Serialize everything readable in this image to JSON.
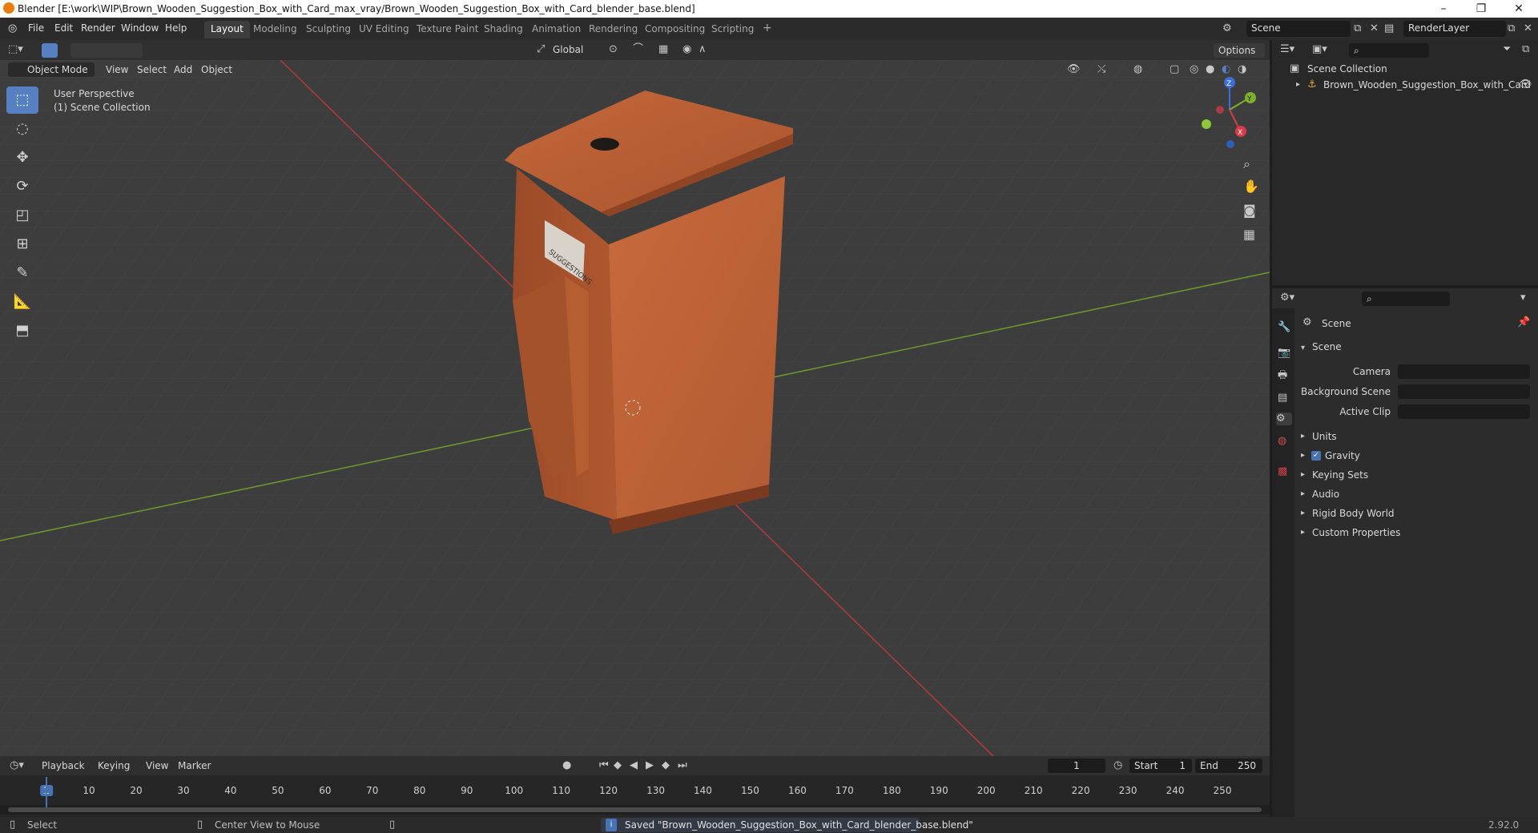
{
  "window": {
    "title": "Blender [E:\\work\\WIP\\Brown_Wooden_Suggestion_Box_with_Card_max_vray/Brown_Wooden_Suggestion_Box_with_Card_blender_base.blend]",
    "minimize": "–",
    "maximize": "❐",
    "close": "✕"
  },
  "menu": [
    "File",
    "Edit",
    "Render",
    "Window",
    "Help"
  ],
  "workspaces": [
    "Layout",
    "Modeling",
    "Sculpting",
    "UV Editing",
    "Texture Paint",
    "Shading",
    "Animation",
    "Rendering",
    "Compositing",
    "Scripting"
  ],
  "workspace_add": "+",
  "scene_field": "Scene",
  "renderlayer_field": "RenderLayer",
  "viewport_header": {
    "transform_orientation": "Global",
    "options": "Options",
    "mode": "Object Mode",
    "view": "View",
    "select": "Select",
    "add": "Add",
    "object": "Object"
  },
  "viewport": {
    "perspective": "User Perspective",
    "collection": "(1) Scene Collection",
    "box_card_text": "SUGGESTIONS",
    "gizmo": {
      "x": "X",
      "y": "Y",
      "z": "Z"
    }
  },
  "outliner": {
    "root": "Scene Collection",
    "items": [
      "Brown_Wooden_Suggestion_Box_with_Card"
    ]
  },
  "properties": {
    "header": "Scene",
    "panel": "Scene",
    "fields": [
      {
        "label": "Camera",
        "value": ""
      },
      {
        "label": "Background Scene",
        "value": ""
      },
      {
        "label": "Active Clip",
        "value": ""
      }
    ],
    "subpanels": [
      "Units",
      "Gravity",
      "Keying Sets",
      "Audio",
      "Rigid Body World",
      "Custom Properties"
    ],
    "gravity_checked": true
  },
  "timeline": {
    "playback": "Playback",
    "keying": "Keying",
    "view": "View",
    "marker": "Marker",
    "current_frame": "1",
    "start_label": "Start",
    "start": "1",
    "end_label": "End",
    "end": "250",
    "ticks": [
      "1",
      "10",
      "20",
      "30",
      "40",
      "50",
      "60",
      "70",
      "80",
      "90",
      "100",
      "110",
      "120",
      "130",
      "140",
      "150",
      "160",
      "170",
      "180",
      "190",
      "200",
      "210",
      "220",
      "230",
      "240",
      "250"
    ]
  },
  "status": {
    "select": "Select",
    "center_view": "Center View to Mouse",
    "message": "Saved \"Brown_Wooden_Suggestion_Box_with_Card_blender_base.blend\"",
    "version": "2.92.0"
  }
}
